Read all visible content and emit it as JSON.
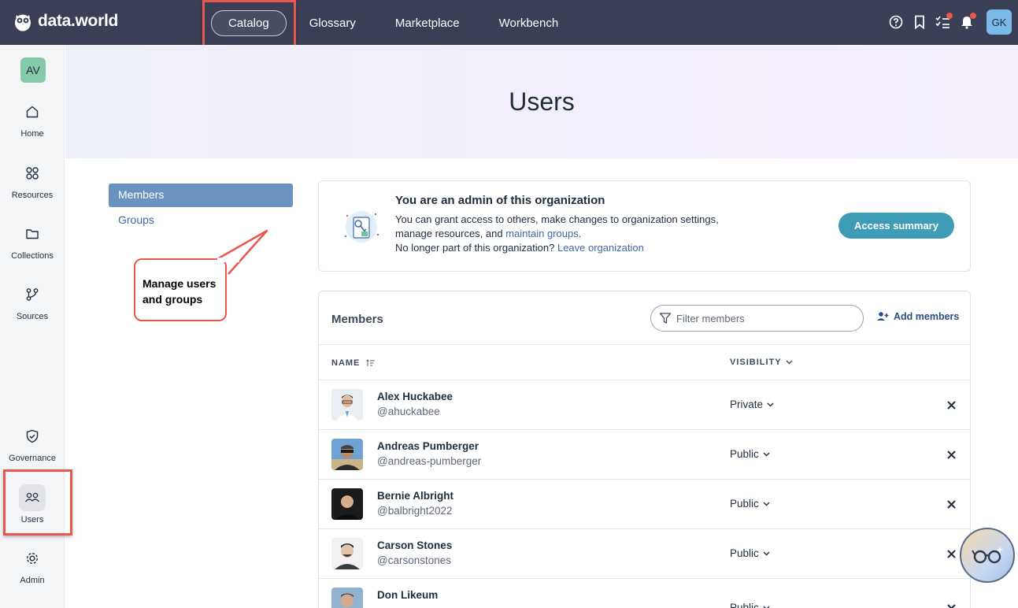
{
  "brand": {
    "name": "data.world"
  },
  "nav": {
    "items": [
      {
        "label": "Catalog",
        "active": true
      },
      {
        "label": "Glossary",
        "active": false
      },
      {
        "label": "Marketplace",
        "active": false
      },
      {
        "label": "Workbench",
        "active": false
      }
    ]
  },
  "topbar": {
    "icons": [
      "help-icon",
      "bookmark-icon",
      "tasks-icon",
      "bell-icon"
    ],
    "user_initials": "GK"
  },
  "sidebar": {
    "org_initials": "AV",
    "items": [
      {
        "label": "Home",
        "icon": "home-icon"
      },
      {
        "label": "Resources",
        "icon": "resources-icon"
      },
      {
        "label": "Collections",
        "icon": "folder-icon"
      },
      {
        "label": "Sources",
        "icon": "sources-icon"
      },
      {
        "label": "Governance",
        "icon": "shield-icon"
      },
      {
        "label": "Users",
        "icon": "users-icon",
        "active": true
      },
      {
        "label": "Admin",
        "icon": "gear-icon"
      }
    ]
  },
  "page": {
    "title": "Users"
  },
  "subnav": {
    "members": "Members",
    "groups": "Groups"
  },
  "callout": {
    "line1": "Manage users",
    "line2": "and groups"
  },
  "admin_card": {
    "title": "You are an admin of this organization",
    "line1": "You can grant access to others, make changes to organization settings,",
    "line2_prefix": "manage resources, and ",
    "line2_link": "maintain groups",
    "line2_suffix": ".",
    "line3_prefix": "No longer part of this organization? ",
    "line3_link": "Leave organization",
    "button": "Access summary"
  },
  "members": {
    "title": "Members",
    "filter_placeholder": "Filter members",
    "add_label": "Add members",
    "col_name": "NAME",
    "col_visibility": "VISIBILITY",
    "rows": [
      {
        "name": "Alex Huckabee",
        "handle": "@ahuckabee",
        "visibility": "Private"
      },
      {
        "name": "Andreas Pumberger",
        "handle": "@andreas-pumberger",
        "visibility": "Public"
      },
      {
        "name": "Bernie Albright",
        "handle": "@balbright2022",
        "visibility": "Public"
      },
      {
        "name": "Carson Stones",
        "handle": "@carsonstones",
        "visibility": "Public"
      },
      {
        "name": "Don Likeum",
        "handle": "",
        "visibility": "Public"
      }
    ]
  },
  "colors": {
    "topbar": "#3b3f55",
    "accent": "#3f9cb6",
    "highlight": "#e8584f",
    "subnav_active": "#6a93c2"
  }
}
